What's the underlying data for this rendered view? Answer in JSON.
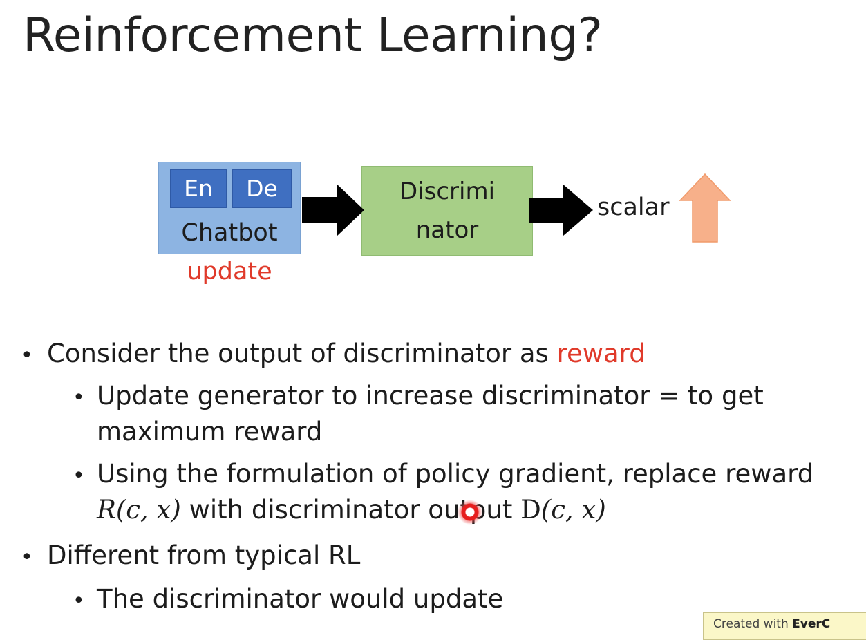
{
  "slide": {
    "title": "Reinforcement Learning?"
  },
  "diagram": {
    "encoder_label": "En",
    "decoder_label": "De",
    "chatbot_label": "Chatbot",
    "update_label": "update",
    "discriminator_line1": "Discrimi",
    "discriminator_line2": "nator",
    "output_label": "scalar"
  },
  "bullets": {
    "b1_text": "Consider the output of discriminator as ",
    "b1_highlight": "reward",
    "b1_1_line1": "Update generator to increase discriminator = to get",
    "b1_1_line2": "maximum reward",
    "b1_2_line1": "Using the formulation of policy gradient, replace reward",
    "b1_2_math_r": "R(c, x)",
    "b1_2_mid": " with discriminator output ",
    "b1_2_math_d_prefix": "D",
    "b1_2_math_d_args": "(c, x)",
    "b2_text": "Different from typical RL",
    "b2_1_text": "The discriminator would update",
    "bullet_char": "•"
  },
  "watermark": {
    "prefix": "Created with ",
    "brand": "EverC"
  },
  "colors": {
    "accent_red": "#e03a2a",
    "chatbot_fill": "#8db4e2",
    "encdec_fill": "#3f6fc1",
    "discriminator_fill": "#a7cf87",
    "up_arrow_fill": "#f7b08a"
  },
  "icons": {
    "flow_arrow": "right-arrow-icon",
    "increase_arrow": "up-arrow-icon",
    "cursor": "pointer-dot-icon"
  }
}
